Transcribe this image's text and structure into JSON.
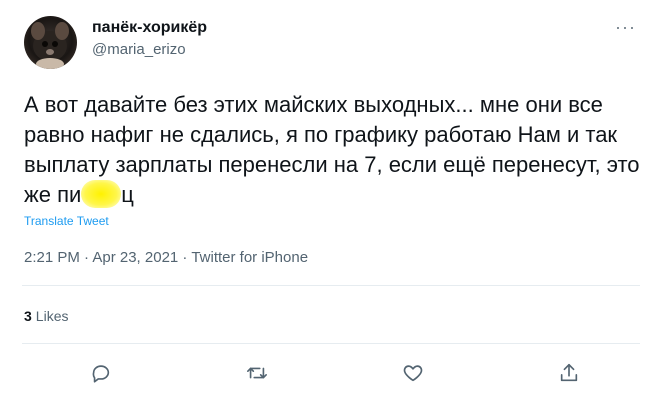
{
  "tweet": {
    "display_name": "панёк-хорикёр",
    "handle": "@maria_erizo",
    "text_part1": "А вот давайте без этих майских выходных... мне они все равно нафиг не сдались, я по графику работаю Нам и так выплату зарплаты перенесли на 7, если ещё перенесут, это же пи",
    "text_part2": "ц",
    "translate_label": "Translate Tweet",
    "timestamp": "2:21 PM · Apr 23, 2021 · Twitter for iPhone",
    "likes_count": "3",
    "likes_label": "Likes"
  },
  "icons": {
    "more": "more-horizontal-icon",
    "reply": "reply-icon",
    "retweet": "retweet-icon",
    "like": "heart-icon",
    "share": "share-icon"
  },
  "colors": {
    "text": "#0f1419",
    "secondary": "#536471",
    "link": "#1d9bf0",
    "highlight": "#fff200"
  }
}
